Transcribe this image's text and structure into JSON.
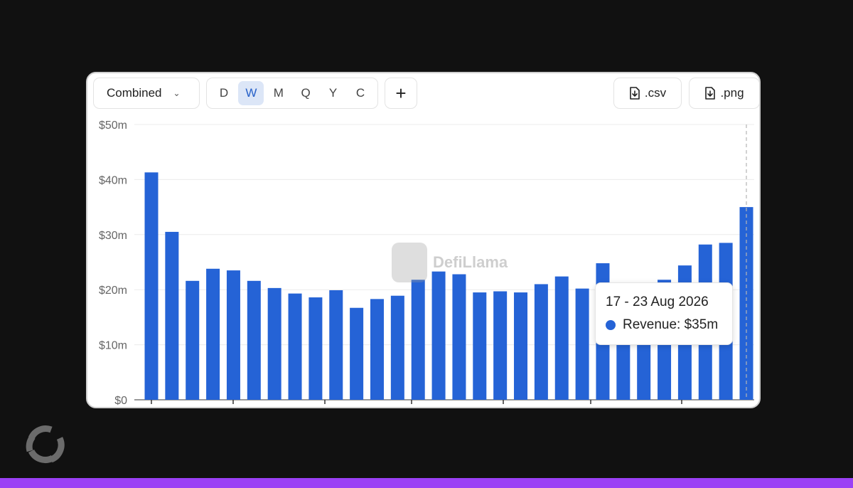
{
  "toolbar": {
    "dropdown_label": "Combined",
    "periods": [
      "D",
      "W",
      "M",
      "Q",
      "Y",
      "C"
    ],
    "active_period": "W",
    "add_label": "+",
    "csv_label": ".csv",
    "png_label": ".png"
  },
  "watermark": {
    "text": "DefiLlama"
  },
  "tooltip": {
    "date": "17 - 23 Aug 2026",
    "label": "Revenue: $35m"
  },
  "colors": {
    "bar": "#2563d6",
    "background": "#111111",
    "accent_bar": "#9b40f5"
  },
  "chart_data": {
    "type": "bar",
    "title": "",
    "xlabel": "",
    "ylabel": "",
    "ylim": [
      0,
      50
    ],
    "y_ticks": [
      "$0",
      "$10m",
      "$20m",
      "$30m",
      "$40m",
      "$50m"
    ],
    "grid": true,
    "series": [
      {
        "name": "Revenue",
        "values": [
          41.3,
          30.5,
          21.6,
          23.8,
          23.5,
          21.6,
          20.3,
          19.3,
          18.6,
          19.9,
          16.7,
          18.3,
          18.9,
          21.8,
          23.3,
          22.8,
          19.5,
          19.7,
          19.5,
          21.0,
          22.4,
          20.2,
          24.8,
          21.2,
          21.0,
          21.8,
          24.4,
          28.2,
          28.5,
          35.0
        ]
      }
    ],
    "highlighted_index": 29
  }
}
